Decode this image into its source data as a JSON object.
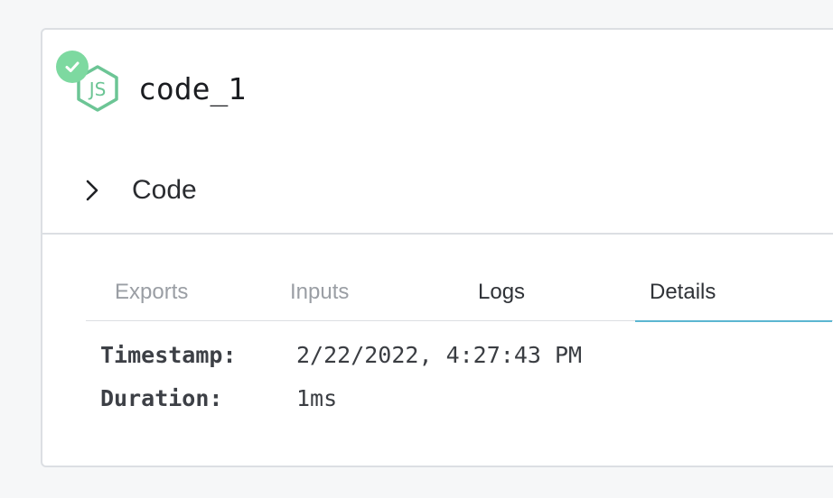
{
  "step": {
    "title": "code_1",
    "status": "success",
    "status_icon": "check-icon",
    "language_icon": "nodejs-icon"
  },
  "code_section": {
    "label": "Code",
    "icon": "chevron-right-icon",
    "expanded": false
  },
  "tabs": [
    {
      "label": "Exports",
      "active": false
    },
    {
      "label": "Inputs",
      "active": false
    },
    {
      "label": "Logs",
      "active": false
    },
    {
      "label": "Details",
      "active": true
    }
  ],
  "details": {
    "timestamp_label": "Timestamp:",
    "timestamp_value": "2/22/2022, 4:27:43 PM",
    "duration_label": "Duration:",
    "duration_value": "1ms"
  },
  "colors": {
    "success": "#7dd9a0",
    "node_green": "#6cc595",
    "tab_accent": "#5bb6d1"
  }
}
